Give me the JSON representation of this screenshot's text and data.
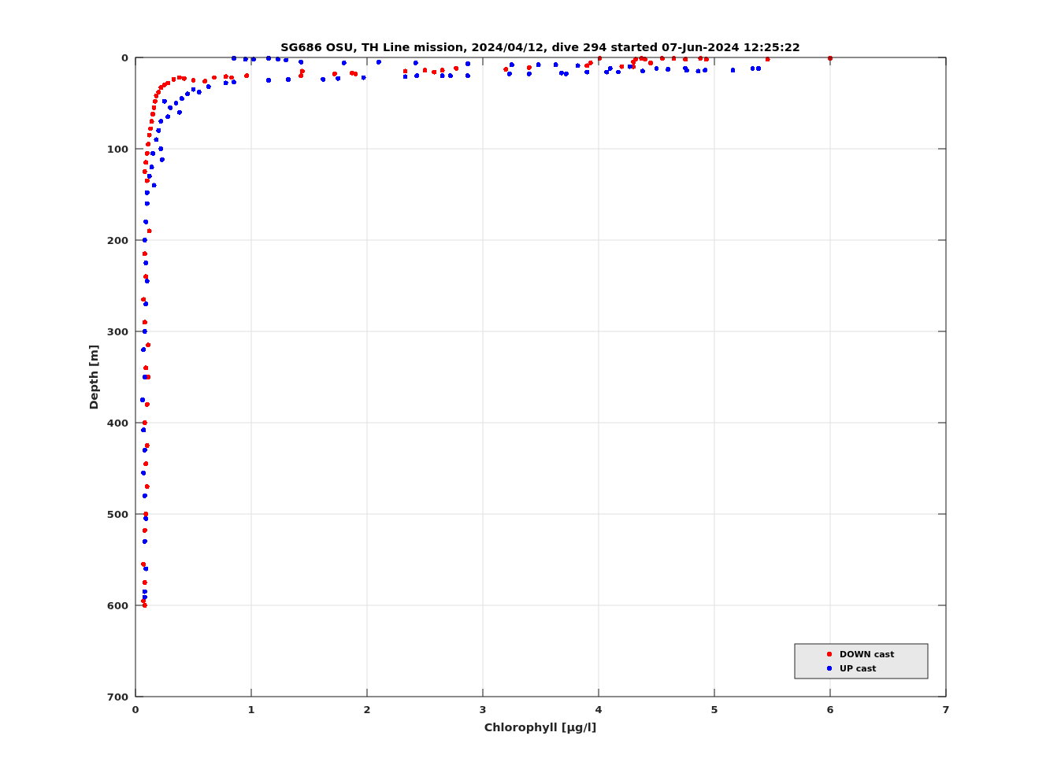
{
  "chart_data": {
    "type": "scatter",
    "title": "SG686 OSU, TH Line mission, 2024/04/12, dive 294 started 07-Jun-2024 12:25:22",
    "xlabel": "Chlorophyll [μg/l]",
    "ylabel": "Depth [m]",
    "grid": true,
    "legend": true,
    "xlim": [
      0,
      7
    ],
    "ylim": [
      700,
      0
    ],
    "xticks": [
      0,
      1,
      2,
      3,
      4,
      5,
      6,
      7
    ],
    "yticks": [
      0,
      100,
      200,
      300,
      400,
      500,
      600,
      700
    ],
    "series": [
      {
        "name": "DOWN cast",
        "color": "#ff0000",
        "x": [
          0.68,
          0.78,
          0.83,
          0.96,
          1.43,
          1.44,
          1.72,
          1.87,
          1.9,
          2.33,
          2.5,
          2.58,
          2.65,
          2.77,
          3.2,
          3.4,
          3.9,
          3.93,
          4.01,
          4.3,
          4.32,
          4.37,
          4.4,
          4.45,
          4.55,
          4.65,
          4.75,
          4.88,
          4.93,
          5.46,
          6.0,
          4.2,
          4.3,
          0.6,
          0.5,
          0.42,
          0.38,
          0.33,
          0.28,
          0.25,
          0.22,
          0.2,
          0.18,
          0.17,
          0.16,
          0.15,
          0.14,
          0.13,
          0.12,
          0.11,
          0.1,
          0.09,
          0.08,
          0.1,
          0.12,
          0.08,
          0.09,
          0.07,
          0.08,
          0.11,
          0.09,
          0.11,
          0.1,
          0.08,
          0.1,
          0.09,
          0.1,
          0.09,
          0.08,
          0.07,
          0.08,
          0.07,
          0.08
        ],
        "values": [
          22,
          21,
          22,
          20,
          20,
          15,
          18,
          17,
          18,
          15,
          14,
          16,
          14,
          12,
          13,
          11,
          9,
          6,
          1,
          5,
          2,
          1,
          2,
          6,
          1,
          1,
          2,
          1,
          2,
          2,
          1,
          10,
          10,
          26,
          25,
          23,
          22,
          24,
          28,
          30,
          33,
          38,
          42,
          48,
          55,
          62,
          70,
          78,
          85,
          95,
          105,
          115,
          125,
          135,
          190,
          215,
          240,
          265,
          290,
          315,
          340,
          350,
          380,
          400,
          425,
          445,
          470,
          500,
          518,
          555,
          575,
          595,
          600
        ]
      },
      {
        "name": "UP cast",
        "color": "#0000ff",
        "x": [
          0.85,
          0.95,
          1.02,
          1.15,
          1.23,
          1.3,
          1.43,
          1.8,
          2.1,
          2.42,
          2.87,
          3.25,
          3.48,
          3.63,
          3.82,
          1.15,
          1.32,
          1.62,
          1.75,
          1.97,
          2.33,
          2.43,
          2.65,
          2.72,
          2.87,
          3.23,
          3.4,
          3.68,
          3.72,
          3.9,
          4.07,
          4.17,
          4.27,
          4.38,
          4.5,
          4.6,
          4.76,
          4.86,
          4.92,
          5.16,
          5.33,
          5.38,
          4.75,
          4.1,
          0.85,
          0.78,
          0.63,
          0.55,
          0.5,
          0.45,
          0.4,
          0.35,
          0.38,
          0.3,
          0.28,
          0.25,
          0.22,
          0.2,
          0.18,
          0.22,
          0.15,
          0.23,
          0.14,
          0.12,
          0.16,
          0.1,
          0.1,
          0.09,
          0.08,
          0.09,
          0.1,
          0.09,
          0.08,
          0.07,
          0.08,
          0.06,
          0.07,
          0.08,
          0.07,
          0.08,
          0.09,
          0.08,
          0.09,
          0.08,
          0.08
        ],
        "values": [
          1,
          2,
          2,
          1,
          2,
          3,
          5,
          6,
          5,
          6,
          7,
          8,
          8,
          8,
          9,
          25,
          24,
          24,
          23,
          22,
          21,
          20,
          20,
          20,
          20,
          18,
          18,
          17,
          18,
          16,
          16,
          16,
          10,
          15,
          12,
          13,
          14,
          15,
          14,
          14,
          12,
          12,
          12,
          12,
          27,
          28,
          32,
          38,
          35,
          40,
          45,
          50,
          60,
          55,
          65,
          48,
          70,
          80,
          90,
          100,
          105,
          112,
          120,
          130,
          140,
          148,
          160,
          180,
          200,
          225,
          245,
          270,
          300,
          320,
          350,
          375,
          408,
          430,
          455,
          480,
          505,
          530,
          560,
          585,
          591
        ]
      }
    ]
  }
}
